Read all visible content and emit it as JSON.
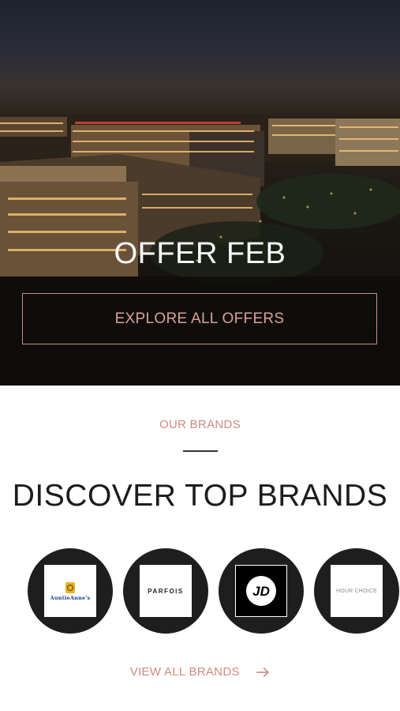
{
  "hero": {
    "title": "OFFER FEB",
    "button_label": "EXPLORE ALL OFFERS"
  },
  "brands_section": {
    "eyebrow": "OUR BRANDS",
    "title": "DISCOVER TOP BRANDS",
    "brands": [
      {
        "name": "AuntieAnne's"
      },
      {
        "name": "PARFOIS"
      },
      {
        "name": "JD"
      },
      {
        "name": "HOUR CHOICE"
      }
    ],
    "view_all_label": "VIEW ALL BRANDS",
    "arrow_icon": "arrow-right-icon"
  },
  "colors": {
    "accent": "#cd8a7f",
    "hero_button_border": "#c98f84",
    "brand_circle": "#1e1e1e"
  }
}
